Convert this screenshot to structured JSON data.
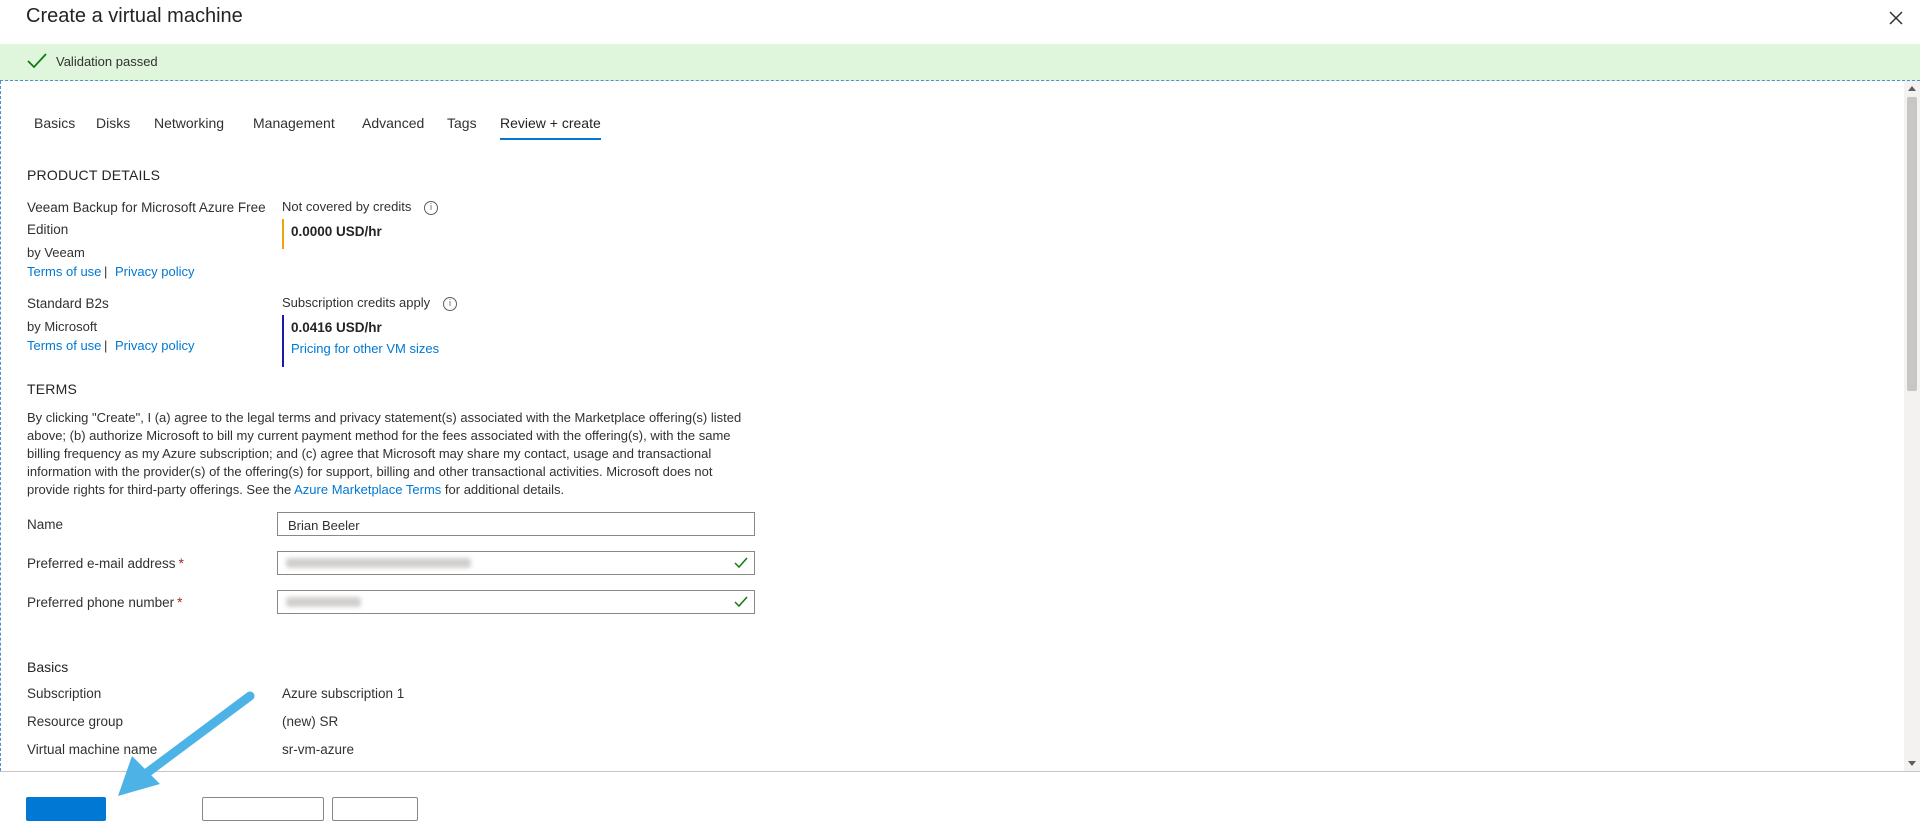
{
  "window": {
    "title": "Create a virtual machine"
  },
  "validation": {
    "text": "Validation passed",
    "color": "#dff6dd"
  },
  "tabs": [
    {
      "label": "Basics"
    },
    {
      "label": "Disks"
    },
    {
      "label": "Networking"
    },
    {
      "label": "Management"
    },
    {
      "label": "Advanced"
    },
    {
      "label": "Tags"
    },
    {
      "label": "Review + create",
      "active": true
    }
  ],
  "product_details": {
    "heading": "PRODUCT DETAILS",
    "items": [
      {
        "name_line1": "Veeam Backup for Microsoft Azure Free",
        "name_line2": "Edition",
        "vendor": "by Veeam",
        "terms_link": "Terms of use",
        "separator": "|",
        "privacy_link": "Privacy policy",
        "credit_note": "Not covered by credits",
        "price": "0.0000 USD/hr",
        "bar_color": "#f0a30a"
      },
      {
        "name_line1": "Standard B2s",
        "vendor": "by Microsoft",
        "terms_link": "Terms of use",
        "separator": "|",
        "privacy_link": "Privacy policy",
        "credit_note": "Subscription credits apply",
        "price": "0.0416 USD/hr",
        "pricing_link": "Pricing for other VM sizes",
        "bar_color": "#1a1aa6"
      }
    ]
  },
  "terms": {
    "heading": "TERMS",
    "text_before": "By clicking \"Create\", I (a) agree to the legal terms and privacy statement(s) associated with the Marketplace offering(s) listed above; (b) authorize Microsoft to bill my current payment method for the fees associated with the offering(s), with the same billing frequency as my Azure subscription; and (c) agree that Microsoft may share my contact, usage and transactional information with the provider(s) of the offering(s) for support, billing and other transactional activities. Microsoft does not provide rights for third-party offerings. See the",
    "link": "Azure Marketplace Terms",
    "text_after": " for additional details."
  },
  "form": {
    "name_label": "Name",
    "name_value": "Brian Beeler",
    "email_label": "Preferred e-mail address",
    "phone_label": "Preferred phone number",
    "required_mark": "*"
  },
  "basics": {
    "heading": "Basics",
    "rows": [
      {
        "key": "Subscription",
        "value": "Azure subscription 1"
      },
      {
        "key": "Resource group",
        "value": "(new) SR"
      },
      {
        "key": "Virtual machine name",
        "value": "sr-vm-azure"
      }
    ]
  },
  "colors": {
    "accent": "#0078d4",
    "valid": "#107c10",
    "annotation_arrow": "#4db3e6"
  }
}
